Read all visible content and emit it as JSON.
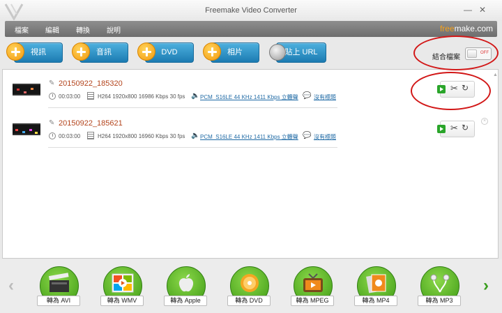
{
  "window": {
    "title": "Freemake Video Converter",
    "minimize_glyph": "—",
    "close_glyph": "✕"
  },
  "menu": {
    "items": [
      "檔案",
      "編輯",
      "轉換",
      "說明"
    ],
    "brand_free": "free",
    "brand_rest": "make.com"
  },
  "toolbar": {
    "video": "視訊",
    "audio": "音訊",
    "dvd": "DVD",
    "photo": "相片",
    "paste_url": "貼上 URL",
    "join_files": "結合檔案",
    "join_state": "OFF"
  },
  "files": [
    {
      "name": "20150922_185320",
      "duration": "00:03:00",
      "video_info": "H264  1920x800  16986 Kbps  30 fps",
      "audio_info": "PCM_S16LE  44 KHz  1411 Kbps  立體聲",
      "subtitles": "沒有標題"
    },
    {
      "name": "20150922_185621",
      "duration": "00:03:00",
      "video_info": "H264  1920x800  16960 Kbps  30 fps",
      "audio_info": "PCM_S16LE  44 KHz  1411 Kbps  立體聲",
      "subtitles": "沒有標題"
    }
  ],
  "converters": [
    "轉為 AVI",
    "轉為 WMV",
    "轉為 Apple",
    "轉為 DVD",
    "轉為 MPEG",
    "轉為 MP4",
    "轉為 MP3"
  ],
  "icons": {
    "pencil": "✎",
    "speaker": "🔈",
    "bubble": "💬",
    "scissors": "✂",
    "rotate": "↻",
    "close": "×",
    "nav_prev": "‹",
    "nav_next": "›",
    "scroll_up": "▲"
  },
  "colors": {
    "accent_blue": "#1c7bb2",
    "plus_orange": "#f39a0f",
    "file_name": "#b3441c",
    "convert_green": "#3d9a14",
    "annotation_red": "#d21717"
  }
}
